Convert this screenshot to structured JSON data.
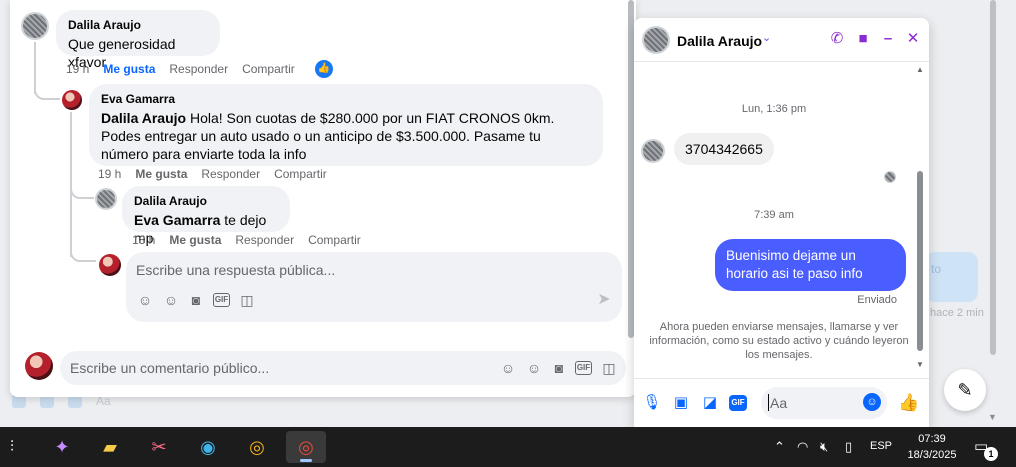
{
  "post": {
    "comments": [
      {
        "author": "Dalila Araujo",
        "text": "Que generosidad xfavor",
        "time": "19 h",
        "like_label": "Me gusta",
        "reply_label": "Responder",
        "share_label": "Compartir"
      }
    ],
    "replies": [
      {
        "author": "Eva Gamarra",
        "mention": "Dalila Araujo",
        "text": " Hola! Son cuotas de $280.000 por un FIAT CRONOS 0km. Podes entregar un auto usado o un anticipo de $3.500.000. Pasame tu número para enviarte toda la info",
        "time": "19 h",
        "like_label": "Me gusta",
        "reply_label": "Responder",
        "share_label": "Compartir"
      },
      {
        "author": "Dalila Araujo",
        "mention": "Eva Gamarra",
        "text": " te dejo mp",
        "time": "18 h",
        "like_label": "Me gusta",
        "reply_label": "Responder",
        "share_label": "Compartir"
      }
    ],
    "reply_placeholder": "Escribe una respuesta pública...",
    "comment_placeholder": "Escribe un comentario público...",
    "background_ghost_text": "Aa"
  },
  "chat": {
    "name": "Dalila Araujo",
    "messages": [
      {
        "kind": "time",
        "text": "Lun, 1:36 pm"
      },
      {
        "kind": "in",
        "text": "3704342665"
      },
      {
        "kind": "time",
        "text": "7:39 am"
      },
      {
        "kind": "out",
        "text": "Buenisimo dejame un horario asi te paso info"
      }
    ],
    "sent_status": "Enviado",
    "seen_note": "Ahora pueden enviarse mensajes, llamarse y ver información, como su estado activo y cuándo leyeron los mensajes.",
    "input_placeholder": "Aa"
  },
  "background": {
    "timestamp": "hace 2 min",
    "card_text": "to"
  },
  "taskbar": {
    "language": "ESP",
    "time": "07:39",
    "date": "18/3/2025",
    "notification_count": "1",
    "apps": [
      "task-view",
      "copilot",
      "file-explorer",
      "snipping-tool",
      "edge",
      "chrome",
      "chrome-profile"
    ]
  },
  "colors": {
    "accent": "#0866ff",
    "messenger_purple": "#8b2bd4",
    "outgoing_bubble": "#4a5dff",
    "taskbar": "#1c1c1c"
  }
}
